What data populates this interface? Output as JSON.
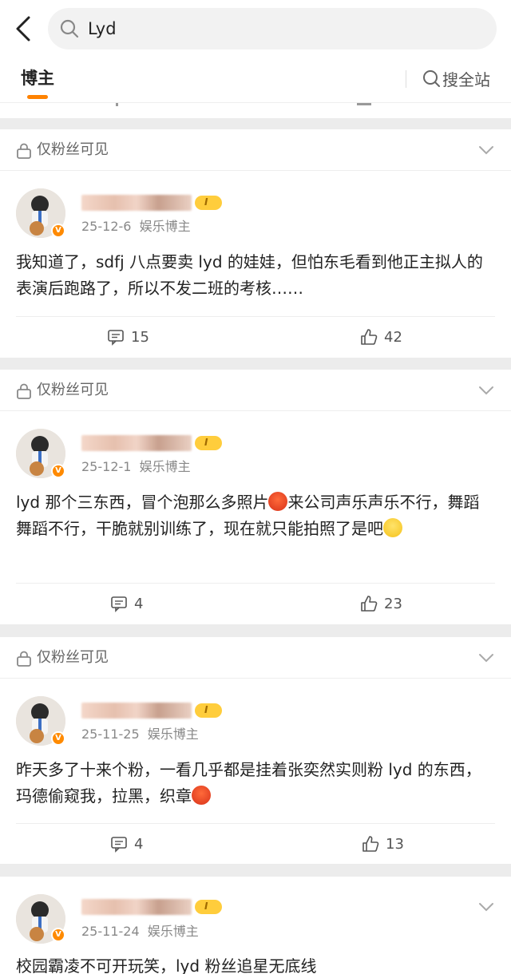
{
  "search": {
    "query": "Lyd"
  },
  "tabs": {
    "author": "博主",
    "search_all": "搜全站"
  },
  "posts": [
    {
      "visibility": "仅粉丝可见",
      "date": "25-12-6",
      "tag": "娱乐博主",
      "text": "我知道了，sdfj 八点要卖 lyd 的娃娃，但怕东毛看到他正主拟人的表演后跑路了，所以不发二班的考核……",
      "comments": "15",
      "likes": "42"
    },
    {
      "visibility": "仅粉丝可见",
      "date": "25-12-1",
      "tag": "娱乐博主",
      "text_a": "lyd 那个三东西，冒个泡那么多照片",
      "text_b": "来公司声乐声乐不行，舞蹈舞蹈不行，干脆就别训练了，现在就只能拍照了是吧",
      "comments": "4",
      "likes": "23"
    },
    {
      "visibility": "仅粉丝可见",
      "date": "25-11-25",
      "tag": "娱乐博主",
      "text_a": "昨天多了十来个粉，一看几乎都是挂着张奕然实则粉 lyd 的东西，玛德偷窥我，拉黑，织章",
      "comments": "4",
      "likes": "13"
    },
    {
      "date": "25-11-24",
      "tag": "娱乐博主",
      "text": "校园霸凌不可开玩笑，lyd 粉丝追星无底线"
    }
  ],
  "colors": {
    "accent": "#ff8200",
    "verified": "#ff8a00",
    "level_badge": "#ffcd3c"
  }
}
